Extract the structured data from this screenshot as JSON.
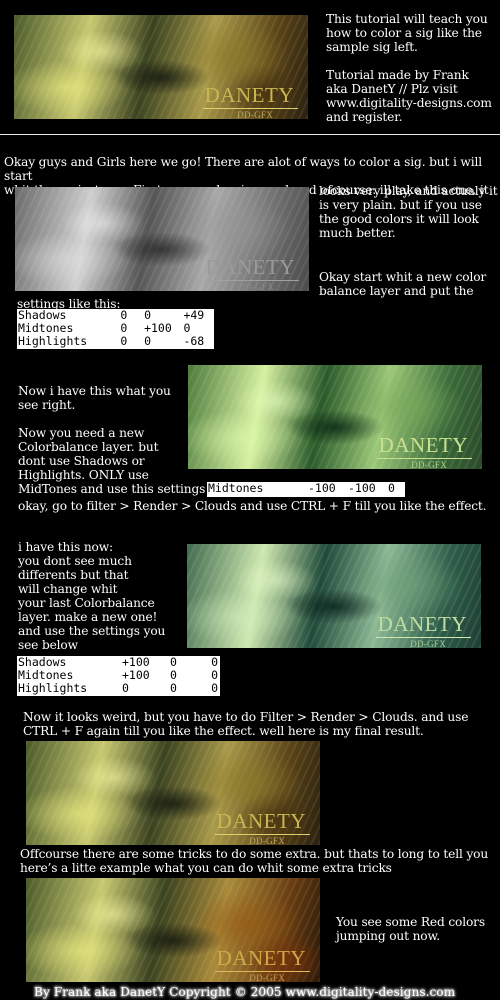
{
  "intro": {
    "text": "This tutorial will teach you\nhow to color a sig like the\nsample sig left.\n\nTutorial made by Frank\naka DanetY // Plz visit\nwww.digitality-designs.com\nand register."
  },
  "sig": {
    "brand": "DANETY",
    "sub": "DD-GFX"
  },
  "step1": {
    "intro": "Okay guys and Girls here we go! There are alot of ways to color a sig. but i will start\nwhit the easiest way.  First you need a sig uncolored ofcourse. ill take this one. it",
    "right": "looks very play, and actualy it\nis very plain. but if you use\nthe good colors it will look\nmuch better.",
    "right2": "Okay start whit a new color\nbalance layer and put the",
    "settings_label": "settings like this:",
    "settings": [
      [
        "Shadows",
        "0",
        "0",
        "+49"
      ],
      [
        "Midtones",
        "0",
        "+100",
        "0"
      ],
      [
        "Highlights",
        "0",
        "0",
        "-68"
      ]
    ]
  },
  "step2": {
    "text": "Now i have this what you\nsee right.\n\nNow you need a new\nColorbalance layer. but\ndont use Shadows or\nHighlights. ONLY use\nMidTones and use this settings",
    "settings": [
      "Midtones",
      "-100",
      "-100",
      "0"
    ],
    "after": "okay, go to filter > Render > Clouds and use CTRL + F till you like the effect."
  },
  "step3": {
    "text": "i have this now:\nyou dont see much\ndifferents but that\nwill change whit\nyour last Colorbalance\nlayer. make a new one!\n and use the settings you\n see below",
    "settings": [
      [
        "Shadows",
        "+100",
        "0",
        "0"
      ],
      [
        "Midtones",
        "+100",
        "0",
        "0"
      ],
      [
        "Highlights",
        "0",
        "0",
        "0"
      ]
    ]
  },
  "step4": {
    "text": "Now it looks weird, but you have to do Filter > Render > Clouds. and use\nCTRL + F again till you like the effect. well here is my final result."
  },
  "step5": {
    "text": "Offcourse there are some tricks to do some extra. but thats to long to tell you\nhere’s a litte example what you can do whit some extra tricks",
    "right": "You  see some Red colors\njumping out now."
  },
  "footer": {
    "text": "By Frank aka DanetY Copyright © 2005  www.digitality-designs.com"
  }
}
